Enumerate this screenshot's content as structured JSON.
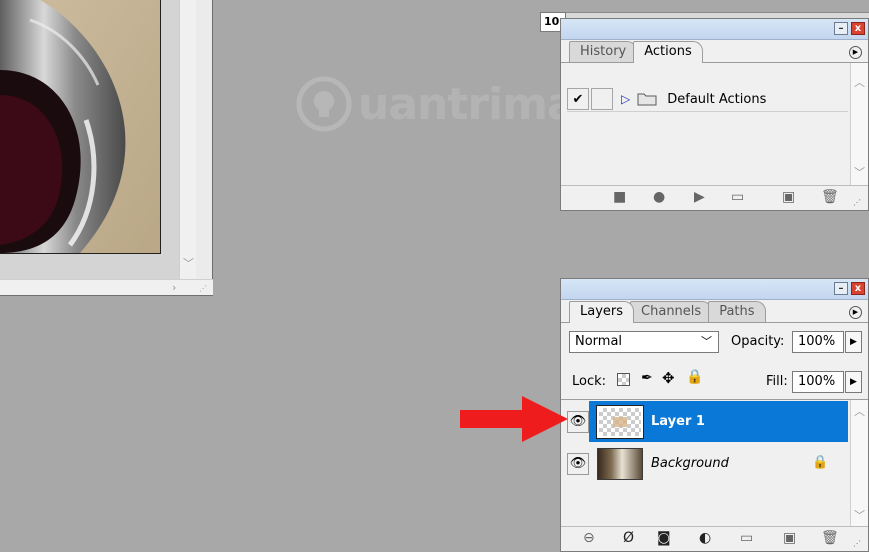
{
  "watermark": {
    "text": "uantrimang"
  },
  "zoom_field": {
    "value": "10"
  },
  "actions_panel": {
    "tabs": [
      {
        "label": "History",
        "active": false
      },
      {
        "label": "Actions",
        "active": true
      }
    ],
    "items": [
      {
        "checked": true,
        "label": "Default Actions"
      }
    ],
    "footer_icons": [
      "stop-icon",
      "record-icon",
      "play-icon",
      "new-set-folder-icon",
      "new-action-icon",
      "trash-icon"
    ]
  },
  "layers_panel": {
    "tabs": [
      {
        "label": "Layers",
        "active": true
      },
      {
        "label": "Channels",
        "active": false
      },
      {
        "label": "Paths",
        "active": false
      }
    ],
    "blend_mode": "Normal",
    "opacity_label": "Opacity:",
    "opacity_value": "100%",
    "lock_label": "Lock:",
    "fill_label": "Fill:",
    "fill_value": "100%",
    "layers": [
      {
        "name": "Layer 1",
        "selected": true,
        "visible": true,
        "locked": false
      },
      {
        "name": "Background",
        "selected": false,
        "visible": true,
        "locked": true
      }
    ],
    "footer_icons": [
      "link-icon",
      "layer-style-icon",
      "mask-icon",
      "adjustment-icon",
      "group-folder-icon",
      "new-layer-icon",
      "trash-icon"
    ]
  },
  "colors": {
    "workspace": "#a8a8a8",
    "selection": "#0a78d7",
    "arrow": "#ee1c1c"
  }
}
